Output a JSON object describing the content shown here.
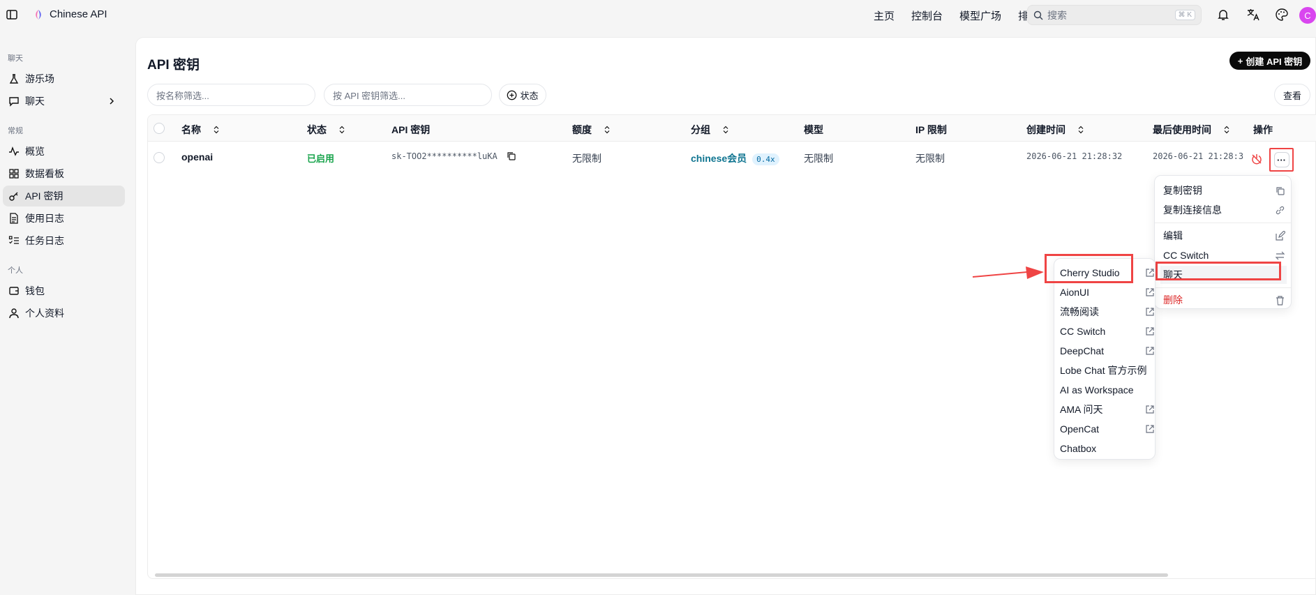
{
  "app": {
    "title": "Chinese API",
    "nav": [
      "主页",
      "控制台",
      "模型广场",
      "排行榜"
    ],
    "search_placeholder": "搜索",
    "search_shortcut": "⌘ K",
    "avatar_letter": "C",
    "accent_color": "#ef4444"
  },
  "sidebar": {
    "sections": [
      {
        "label": "聊天",
        "items": [
          {
            "label": "游乐场",
            "icon": "flask-icon"
          },
          {
            "label": "聊天",
            "icon": "chat-icon",
            "has_submenu": true
          }
        ]
      },
      {
        "label": "常规",
        "items": [
          {
            "label": "概览",
            "icon": "activity-icon"
          },
          {
            "label": "数据看板",
            "icon": "dashboard-icon"
          },
          {
            "label": "API 密钥",
            "icon": "key-icon",
            "active": true
          },
          {
            "label": "使用日志",
            "icon": "document-icon"
          },
          {
            "label": "任务日志",
            "icon": "list-checks-icon"
          }
        ]
      },
      {
        "label": "个人",
        "items": [
          {
            "label": "钱包",
            "icon": "wallet-icon"
          },
          {
            "label": "个人资料",
            "icon": "user-icon"
          }
        ]
      }
    ]
  },
  "main": {
    "title": "API 密钥",
    "create_button": "创建 API 密钥",
    "filter_name_placeholder": "按名称筛选...",
    "filter_key_placeholder": "按 API 密钥筛选...",
    "status_button": "状态",
    "view_button": "查看",
    "columns": [
      "名称",
      "状态",
      "API 密钥",
      "额度",
      "分组",
      "模型",
      "IP 限制",
      "创建时间",
      "最后使用时间",
      "操作"
    ],
    "rows": [
      {
        "name": "openai",
        "status": "已启用",
        "api_key": "sk-TOO2**********luKA",
        "quota": "无限制",
        "group": "chinese会员",
        "group_ratio": "0.4x",
        "models": "无限制",
        "ip_limit": "无限制",
        "created": "2026-06-21 21:28:32",
        "last_used": "2026-06-21 21:28:3"
      }
    ]
  },
  "action_menu": {
    "items": [
      "复制密钥",
      "复制连接信息",
      "编辑",
      "CC Switch",
      "聊天",
      "删除"
    ]
  },
  "chat_submenu": {
    "items": [
      "Cherry Studio",
      "AionUI",
      "流畅阅读",
      "CC Switch",
      "DeepChat",
      "Lobe Chat 官方示例",
      "AI as Workspace",
      "AMA 问天",
      "OpenCat",
      "Chatbox"
    ]
  }
}
